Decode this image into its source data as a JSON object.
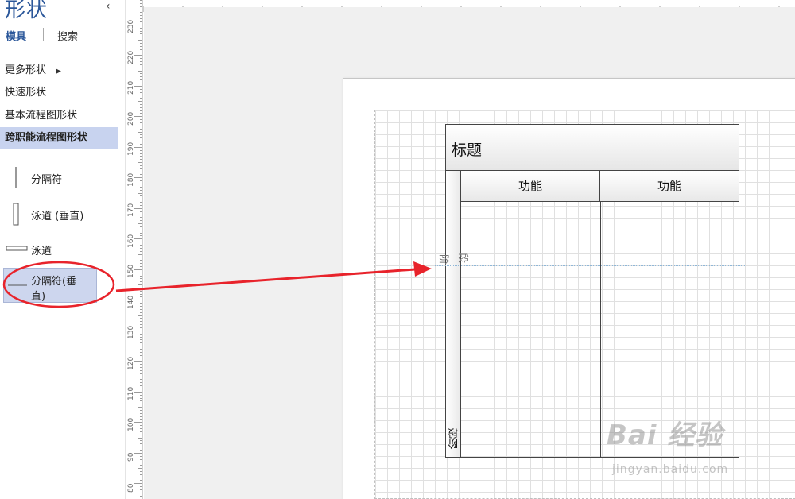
{
  "panel": {
    "title": "形状",
    "collapse_icon": "‹",
    "tabs": {
      "stencils": "模具",
      "search": "搜索"
    },
    "menu": {
      "more_shapes": "更多形状",
      "quick_shapes": "快速形状",
      "basic_flowchart": "基本流程图形状",
      "cross_functional": "跨职能流程图形状"
    },
    "shapes": {
      "separator": "分隔符",
      "swimlane_vertical": "泳道 (垂直)",
      "swimlane": "泳道",
      "separator_vertical_line1": "分隔符(垂",
      "separator_vertical_line2": "直)"
    }
  },
  "ruler": {
    "labels": [
      "230",
      "220",
      "210",
      "200",
      "190",
      "180",
      "170",
      "160",
      "150",
      "140",
      "130",
      "120",
      "110",
      "100",
      "90",
      "80"
    ]
  },
  "diagram": {
    "title": "标题",
    "lane1": "功能",
    "lane2": "功能",
    "phase_bottom": "阶段",
    "phase_moving_a": "阶",
    "phase_moving_b": "段"
  },
  "watermark": {
    "main": "Bai 经验",
    "sub": "jingyan.baidu.com"
  },
  "colors": {
    "accent": "#2b579a",
    "selected_bg": "#c8d3ef",
    "annotation": "#e8232b"
  }
}
